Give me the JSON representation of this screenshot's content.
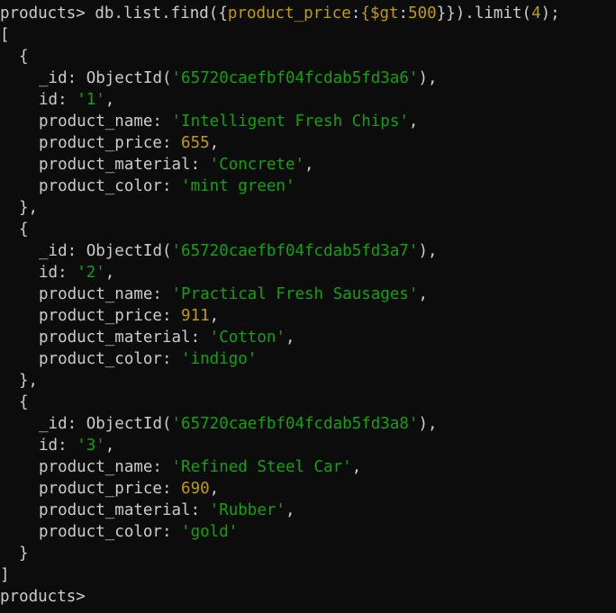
{
  "terminal": {
    "command": {
      "prompt": "products> ",
      "cmd_prefix": "db.list.find({",
      "filter_field": "product_price",
      "colon": ":",
      "brace_open": "{",
      "operator": "$gt",
      "operator_colon": ":",
      "operator_value": "500",
      "cmd_middle": "}}).limit(",
      "limit_value": "4",
      "cmd_suffix": ");"
    },
    "open_bracket": "[",
    "close_bracket": "]",
    "documents": [
      {
        "open": "{",
        "close": "},",
        "oid_key": "_id: ",
        "oid_func": "ObjectId(",
        "oid_value": "'65720caefbf04fcdab5fd3a6'",
        "oid_close": "),",
        "id_key": "id: ",
        "id_value": "'1'",
        "id_comma": ",",
        "name_key": "product_name: ",
        "name_value": "'Intelligent Fresh Chips'",
        "name_comma": ",",
        "price_key": "product_price: ",
        "price_value": "655",
        "price_comma": ",",
        "material_key": "product_material: ",
        "material_value": "'Concrete'",
        "material_comma": ",",
        "color_key": "product_color: ",
        "color_value": "'mint green'"
      },
      {
        "open": "{",
        "close": "},",
        "oid_key": "_id: ",
        "oid_func": "ObjectId(",
        "oid_value": "'65720caefbf04fcdab5fd3a7'",
        "oid_close": "),",
        "id_key": "id: ",
        "id_value": "'2'",
        "id_comma": ",",
        "name_key": "product_name: ",
        "name_value": "'Practical Fresh Sausages'",
        "name_comma": ",",
        "price_key": "product_price: ",
        "price_value": "911",
        "price_comma": ",",
        "material_key": "product_material: ",
        "material_value": "'Cotton'",
        "material_comma": ",",
        "color_key": "product_color: ",
        "color_value": "'indigo'"
      },
      {
        "open": "{",
        "close": "}",
        "oid_key": "_id: ",
        "oid_func": "ObjectId(",
        "oid_value": "'65720caefbf04fcdab5fd3a8'",
        "oid_close": "),",
        "id_key": "id: ",
        "id_value": "'3'",
        "id_comma": ",",
        "name_key": "product_name: ",
        "name_value": "'Refined Steel Car'",
        "name_comma": ",",
        "price_key": "product_price: ",
        "price_value": "690",
        "price_comma": ",",
        "material_key": "product_material: ",
        "material_value": "'Rubber'",
        "material_comma": ",",
        "color_key": "product_color: ",
        "color_value": "'gold'"
      }
    ],
    "final_prompt": "products> ",
    "colors": {
      "background": "#0c0c0c",
      "text": "#cccccc",
      "number": "#c19c00",
      "string": "#13a10e"
    }
  }
}
